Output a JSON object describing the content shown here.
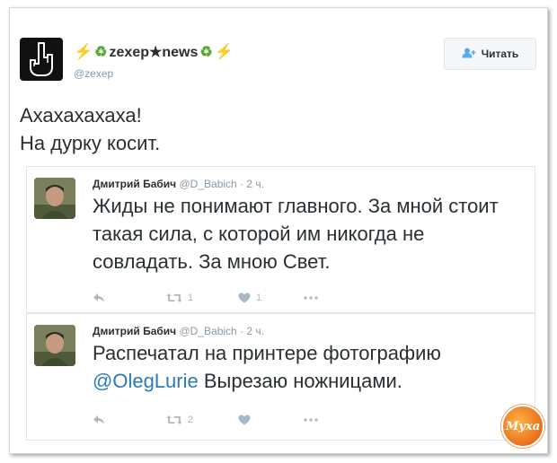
{
  "author": {
    "display_name": "zexep★news",
    "handle": "@zexep",
    "avatar_icon": "middle-finger-icon",
    "decor_icons": [
      "lightning-icon",
      "recycle-icon"
    ]
  },
  "follow_button": {
    "label": "Читать",
    "icon": "add-user-icon"
  },
  "tweet": {
    "line1": "Ахахахахаха!",
    "line2": "На дурку косит."
  },
  "quotes": [
    {
      "name": "Дмитрий Бабич",
      "handle": "@D_Babich",
      "time": "· 2 ч.",
      "text": "Жиды не понимают главного. За мной стоит такая сила, с которой им никогда не совладать. За мною Свет.",
      "retweets": "1",
      "likes": "1"
    },
    {
      "name": "Дмитрий Бабич",
      "handle": "@D_Babich",
      "time": "· 2 ч.",
      "text_before": "Распечатал на принтере фотографию ",
      "mention": "@OlegLurie",
      "text_after": " Вырезаю ножницами.",
      "retweets": "2",
      "likes": ""
    }
  ],
  "watermark": {
    "label": "Муха"
  },
  "colors": {
    "link": "#2b7bb9",
    "muted": "#8899a6",
    "action": "#aab8c2",
    "accent": "#55acee"
  }
}
